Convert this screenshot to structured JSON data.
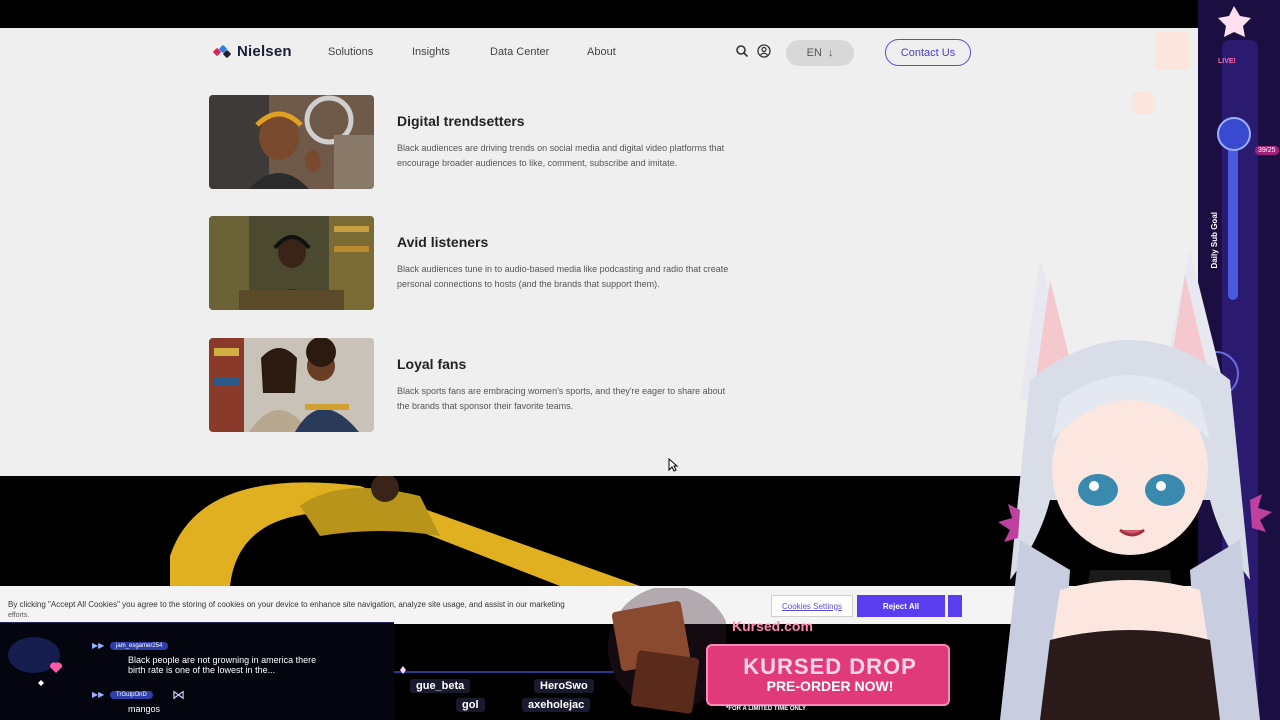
{
  "nav": {
    "logo": "Nielsen",
    "links": [
      "Solutions",
      "Insights",
      "Data Center",
      "About"
    ],
    "lang": "EN",
    "contact": "Contact Us"
  },
  "cards": [
    {
      "title": "Digital trendsetters",
      "body": "Black audiences are driving trends on social media and digital video platforms that encourage broader audiences to like, comment, subscribe and imitate."
    },
    {
      "title": "Avid listeners",
      "body": "Black audiences tune in to audio-based media like podcasting and radio that create personal connections to hosts (and the brands that support them)."
    },
    {
      "title": "Loyal fans",
      "body": "Black sports fans are embracing women's sports, and they're eager to share about the brands that sponsor their favorite teams."
    }
  ],
  "cookie": {
    "text": "By clicking \"Accept All Cookies\" you agree to the storing of cookies on your device to enhance site navigation, analyze site usage, and assist in our marketing",
    "text2": "efforts.",
    "settings": "Cookies Settings",
    "reject": "Reject All"
  },
  "chat": {
    "messages": [
      {
        "user": "jam_esgamer254",
        "text": "Black people are not growning in america there birth rate is one of the lowest in the..."
      },
      {
        "user": "TrGutpOnD",
        "text": "mangos"
      }
    ]
  },
  "ticker": {
    "names": [
      "gue_beta",
      "HeroSwo",
      "gol",
      "axeholejac"
    ]
  },
  "promo": {
    "brand": "Kursed.com",
    "title": "KURSED DROP",
    "subtitle": "PRE-ORDER NOW!",
    "note": "*FOR A LIMITED TIME ONLY"
  },
  "stream": {
    "goal_label": "Daily Sub Goal",
    "goal_count": "39/25",
    "live": "LIVE!"
  },
  "colors": {
    "accent": "#5b3df0",
    "site_bg": "#efefef",
    "promo_pink": "#e03a7a"
  }
}
